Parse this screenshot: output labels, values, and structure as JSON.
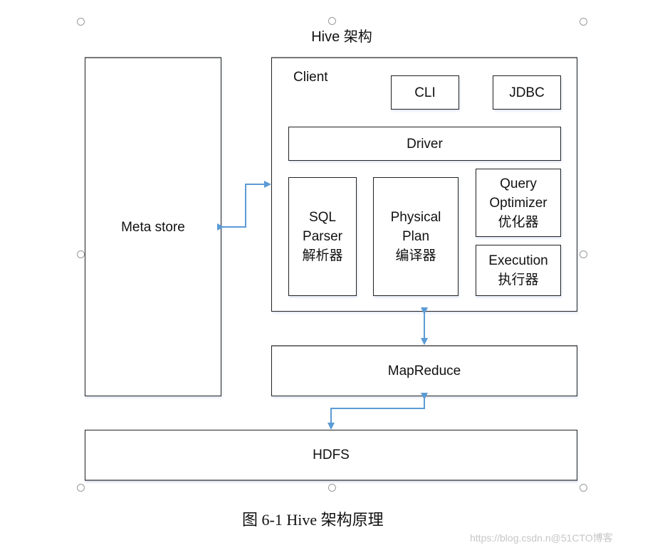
{
  "diagram": {
    "title": "Hive 架构",
    "caption": "图 6-1 Hive 架构原理",
    "watermark": "https://blog.csdn.n@51CTO博客",
    "accent_color": "#5b9bd5",
    "nodes": {
      "metastore": "Meta store",
      "client_container": "Client",
      "cli": "CLI",
      "jdbc": "JDBC",
      "driver": "Driver",
      "sql_parser": [
        "SQL",
        "Parser",
        "解析器"
      ],
      "physical_plan": [
        "Physical",
        "Plan",
        "编译器"
      ],
      "query_optimizer": [
        "Query",
        "Optimizer",
        "优化器"
      ],
      "execution": [
        "Execution",
        "执行器"
      ],
      "mapreduce": "MapReduce",
      "hdfs": "HDFS"
    },
    "edges": [
      {
        "from": "metastore",
        "to": "client_container",
        "direction": "bidirectional"
      },
      {
        "from": "client_container",
        "to": "mapreduce",
        "direction": "bidirectional"
      },
      {
        "from": "mapreduce",
        "to": "hdfs",
        "direction": "bidirectional"
      }
    ]
  }
}
